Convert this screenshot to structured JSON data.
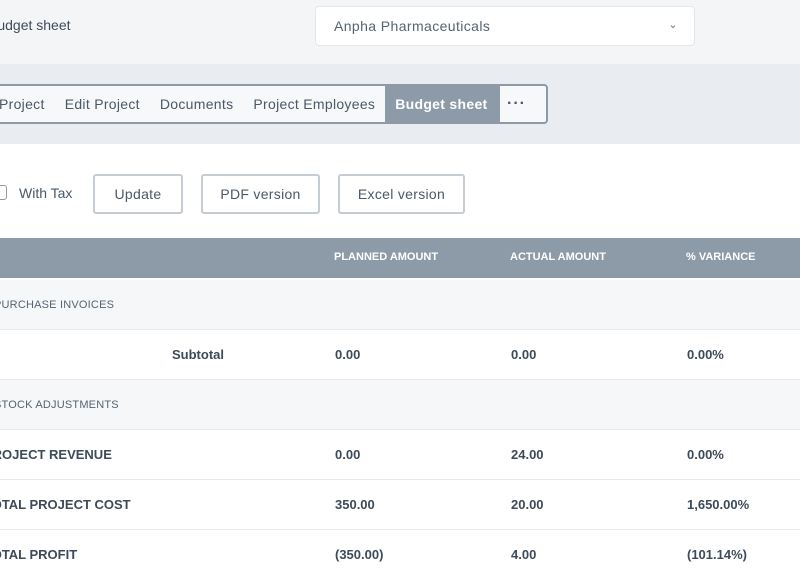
{
  "header": {
    "page_title": "Budget sheet",
    "company_select": {
      "value": "Anpha Pharmaceuticals",
      "chevron_icon": "chevron-down-icon"
    }
  },
  "tabs": [
    {
      "label": "Project",
      "active": false
    },
    {
      "label": "Edit Project",
      "active": false
    },
    {
      "label": "Documents",
      "active": false
    },
    {
      "label": "Project Employees",
      "active": false
    },
    {
      "label": "Budget sheet",
      "active": true
    },
    {
      "label": "···",
      "icon": "more-horizontal-icon",
      "active": false
    }
  ],
  "toolbar": {
    "with_tax_label": "With Tax",
    "with_tax_checked": false,
    "update_label": "Update",
    "pdf_label": "PDF version",
    "excel_label": "Excel version"
  },
  "table": {
    "columns": [
      "PLANNED AMOUNT",
      "ACTUAL AMOUNT",
      "% VARIANCE"
    ],
    "rows": [
      {
        "label": "PURCHASE INVOICES",
        "type": "section"
      },
      {
        "label": "Subtotal",
        "planned": "0.00",
        "actual": "0.00",
        "variance": "0.00%",
        "type": "subtotal"
      },
      {
        "label": "STOCK ADJUSTMENTS",
        "type": "section"
      },
      {
        "label": "PROJECT REVENUE",
        "planned": "0.00",
        "actual": "24.00",
        "variance": "0.00%",
        "type": "total"
      },
      {
        "label": "TOTAL PROJECT COST",
        "planned": "350.00",
        "actual": "20.00",
        "variance": "1,650.00%",
        "type": "total"
      },
      {
        "label": "TOTAL PROFIT",
        "planned": "(350.00)",
        "actual": "4.00",
        "variance": "(101.14%)",
        "type": "total"
      }
    ]
  },
  "colors": {
    "accent": "#8d9aa8",
    "band": "#e9ecf0",
    "text": "#475566"
  }
}
